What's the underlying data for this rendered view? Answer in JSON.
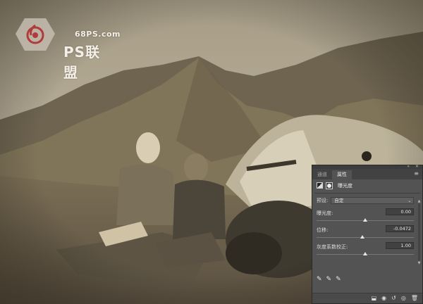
{
  "watermark": {
    "url": "68PS.com",
    "brand": "PS联盟"
  },
  "panel": {
    "tabs": [
      {
        "label": "通道",
        "active": false
      },
      {
        "label": "属性",
        "active": true
      }
    ],
    "adjustment_title": "曝光度",
    "preset": {
      "label": "预设:",
      "value": "自定"
    },
    "sliders": {
      "exposure": {
        "label": "曝光度:",
        "value": "0.00",
        "fraction": 0.5
      },
      "offset": {
        "label": "位移:",
        "value": "-0.0472",
        "fraction": 0.47
      },
      "gamma": {
        "label": "灰度系数校正:",
        "value": "1.00",
        "fraction": 0.5
      }
    },
    "icons": {
      "pickers": [
        "black-eyedropper-icon",
        "gray-eyedropper-icon",
        "white-eyedropper-icon"
      ],
      "bottom": [
        "clip-to-layer-icon",
        "view-previous-icon",
        "reset-icon",
        "visibility-icon",
        "delete-icon"
      ]
    },
    "colors": {
      "panel_bg": "#535353",
      "tab_bar_bg": "#424242"
    }
  }
}
